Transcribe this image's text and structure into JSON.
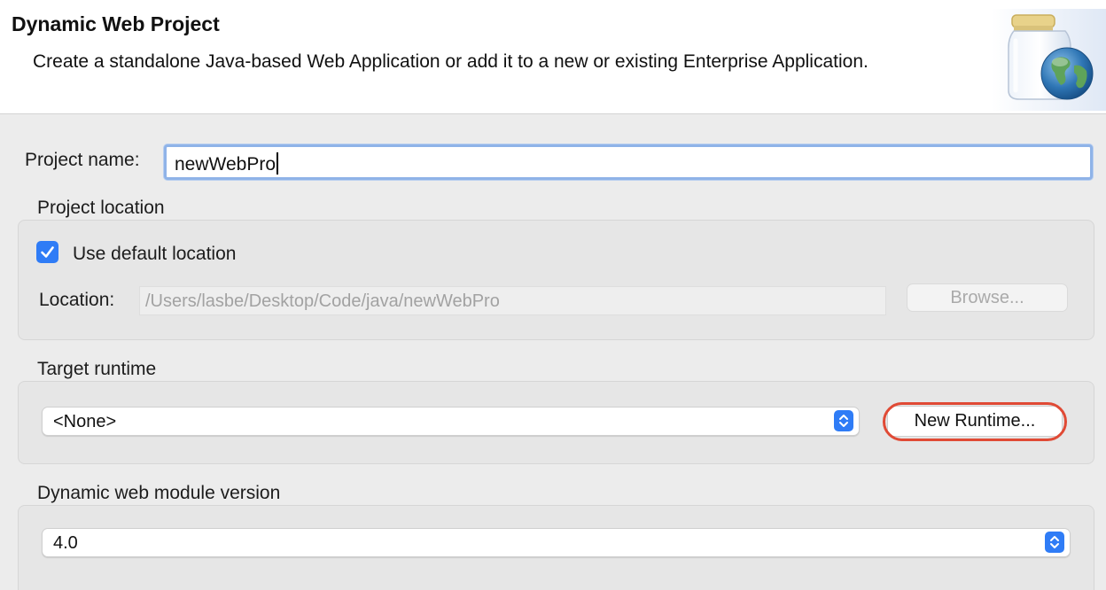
{
  "header": {
    "title": "Dynamic Web Project",
    "description": "Create a standalone Java-based Web Application or add it to a new or existing Enterprise Application.",
    "icon": "globe-jar-icon"
  },
  "project_name": {
    "label": "Project name:",
    "value": "newWebPro"
  },
  "project_location": {
    "section_label": "Project location",
    "use_default_label": "Use default location",
    "use_default_checked": true,
    "location_label": "Location:",
    "location_value": "/Users/lasbe/Desktop/Code/java/newWebPro",
    "browse_label": "Browse..."
  },
  "target_runtime": {
    "section_label": "Target runtime",
    "selected": "<None>",
    "new_runtime_label": "New Runtime..."
  },
  "web_module": {
    "section_label": "Dynamic web module version",
    "selected": "4.0"
  },
  "colors": {
    "accent": "#2f7cf6",
    "highlight": "#e04a35",
    "focus_ring": "#8fb3e8"
  }
}
